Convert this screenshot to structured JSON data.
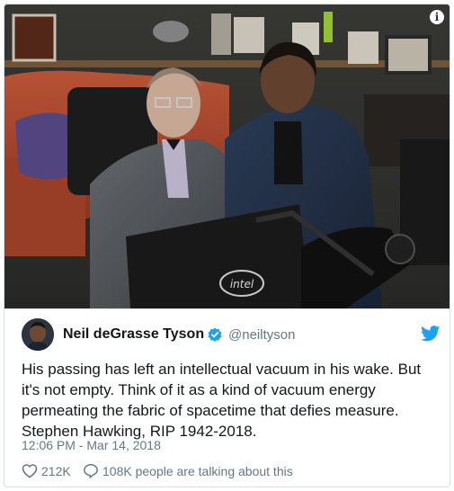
{
  "tweet": {
    "author_name": "Neil deGrasse Tyson",
    "author_handle": "@neiltyson",
    "text": "His passing has left an intellectual vacuum in his wake. But it's not empty. Think of it as a kind of vacuum energy permeating the fabric of spacetime that defies measure. Stephen Hawking, RIP 1942-2018.",
    "timestamp": "12:06 PM - Mar 14, 2018",
    "likes": "212K",
    "talking": "108K people are talking about this"
  },
  "photo": {
    "device_label": "intel"
  },
  "colors": {
    "twitter_blue": "#1da1f2",
    "text_primary": "#14171a",
    "text_secondary": "#657786"
  },
  "icons": [
    "info-icon",
    "verified-badge-icon",
    "twitter-bird-icon",
    "heart-icon",
    "reply-bubble-icon"
  ]
}
